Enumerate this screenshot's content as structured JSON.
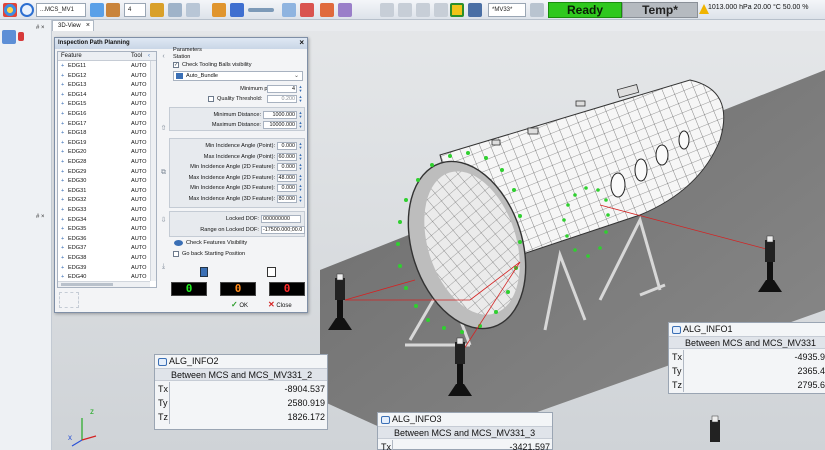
{
  "toolbar": {
    "mcs_combo": "...MCS_MV1",
    "zoom_combo": "4",
    "mv_combo": "*MV33*",
    "ready_label": "Ready",
    "temp_label": "Temp*",
    "env_readout": "1013.000 hPa  20.00 °C  50.00 %",
    "status_ready_color": "#2fc81e",
    "status_temp_color": "#b5bac0"
  },
  "tabs": {
    "view_tab": "3D-View",
    "close_glyph": "×"
  },
  "left_strip": {
    "pin1": "# ×",
    "pin2": "# ×"
  },
  "dialog": {
    "title": "Inspection Path Planning",
    "close_glyph": "×",
    "list": {
      "col_feature": "Feature",
      "col_tool": "Tool",
      "rows": [
        {
          "name": "EDG11",
          "tool": "AUTO"
        },
        {
          "name": "EDG12",
          "tool": "AUTO"
        },
        {
          "name": "EDG13",
          "tool": "AUTO"
        },
        {
          "name": "EDG14",
          "tool": "AUTO"
        },
        {
          "name": "EDG15",
          "tool": "AUTO"
        },
        {
          "name": "EDG16",
          "tool": "AUTO"
        },
        {
          "name": "EDG17",
          "tool": "AUTO"
        },
        {
          "name": "EDG18",
          "tool": "AUTO"
        },
        {
          "name": "EDG19",
          "tool": "AUTO"
        },
        {
          "name": "EDG20",
          "tool": "AUTO"
        },
        {
          "name": "EDG28",
          "tool": "AUTO"
        },
        {
          "name": "EDG29",
          "tool": "AUTO"
        },
        {
          "name": "EDG30",
          "tool": "AUTO"
        },
        {
          "name": "EDG31",
          "tool": "AUTO"
        },
        {
          "name": "EDG32",
          "tool": "AUTO"
        },
        {
          "name": "EDG33",
          "tool": "AUTO"
        },
        {
          "name": "EDG34",
          "tool": "AUTO"
        },
        {
          "name": "EDG35",
          "tool": "AUTO"
        },
        {
          "name": "EDG36",
          "tool": "AUTO"
        },
        {
          "name": "EDG37",
          "tool": "AUTO"
        },
        {
          "name": "EDG38",
          "tool": "AUTO"
        },
        {
          "name": "EDG39",
          "tool": "AUTO"
        },
        {
          "name": "EDG40",
          "tool": "AUTO"
        }
      ]
    },
    "params": {
      "heading": "Parameters",
      "station_label": "Station",
      "check_tooling_label": "Check Tooling Balls visibility",
      "bundle_value": "Auto_Bundle",
      "min_per_station_label": "Minimum per Station:",
      "min_per_station_value": "4",
      "quality_threshold_label": "Quality Threshold:",
      "quality_threshold_value": "0.200",
      "min_distance_label": "Minimum Distance:",
      "min_distance_value": "1000.000",
      "max_distance_label": "Maximum Distance:",
      "max_distance_value": "10000.000",
      "angles": [
        {
          "label": "Min Incidence Angle (Point):",
          "value": "0.000"
        },
        {
          "label": "Max Incidence Angle (Point):",
          "value": "60.000"
        },
        {
          "label": "Min Incidence Angle (2D Feature):",
          "value": "0.000"
        },
        {
          "label": "Max Incidence Angle (2D Feature):",
          "value": "48.000"
        },
        {
          "label": "Min Incidence Angle (3D Feature):",
          "value": "0.000"
        },
        {
          "label": "Max Incidence Angle (3D Feature):",
          "value": "80.000"
        }
      ],
      "locked_dof_label": "Locked DOF:",
      "locked_dof_value": "000000000",
      "range_locked_dof_label": "Range on Locked DOF:",
      "range_locked_dof_value": "-17500.000;00.0",
      "check_features_label": "Check Features Visibility",
      "go_back_label": "Go back Starting Position"
    },
    "counters": [
      {
        "value": "0",
        "color": "#22ee22"
      },
      {
        "value": "0",
        "color": "#ff8a1a"
      },
      {
        "value": "0",
        "color": "#ff2a2a"
      }
    ],
    "ok_label": "OK",
    "close_label": "Close"
  },
  "info": [
    {
      "title": "ALG_INFO2",
      "subtitle": "Between MCS and MCS_MV331_2",
      "rows": [
        {
          "key": "Tx",
          "value": "-8904.537"
        },
        {
          "key": "Ty",
          "value": "2580.919"
        },
        {
          "key": "Tz",
          "value": "1826.172"
        }
      ]
    },
    {
      "title": "ALG_INFO1",
      "subtitle": "Between MCS and MCS_MV331",
      "rows": [
        {
          "key": "Tx",
          "value": "-4935.9"
        },
        {
          "key": "Ty",
          "value": "2365.4"
        },
        {
          "key": "Tz",
          "value": "2795.6"
        }
      ]
    },
    {
      "title": "ALG_INFO3",
      "subtitle": "Between MCS and MCS_MV331_3",
      "rows": [
        {
          "key": "Tx",
          "value": "-3421.597"
        }
      ]
    }
  ]
}
